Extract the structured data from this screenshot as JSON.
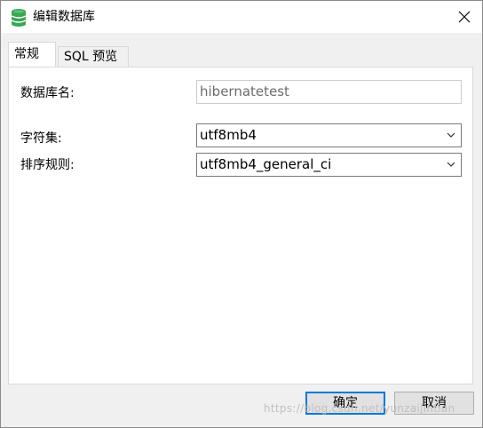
{
  "window": {
    "title": "编辑数据库",
    "title_icon": "database-icon",
    "close_icon": "close-icon"
  },
  "tabs": [
    {
      "label": "常规",
      "active": true
    },
    {
      "label": "SQL 预览",
      "active": false
    }
  ],
  "form": {
    "dbname_label": "数据库名:",
    "dbname_value": "hibernatetest",
    "charset_label": "字符集:",
    "charset_value": "utf8mb4",
    "collation_label": "排序规则:",
    "collation_value": "utf8mb4_general_ci"
  },
  "buttons": {
    "ok_label": "确定",
    "cancel_label": "取消"
  },
  "watermark": "https://blog.csdn.net/yunzaijintian",
  "colors": {
    "accent": "#0078d7",
    "db_icon": "#3aa655"
  }
}
